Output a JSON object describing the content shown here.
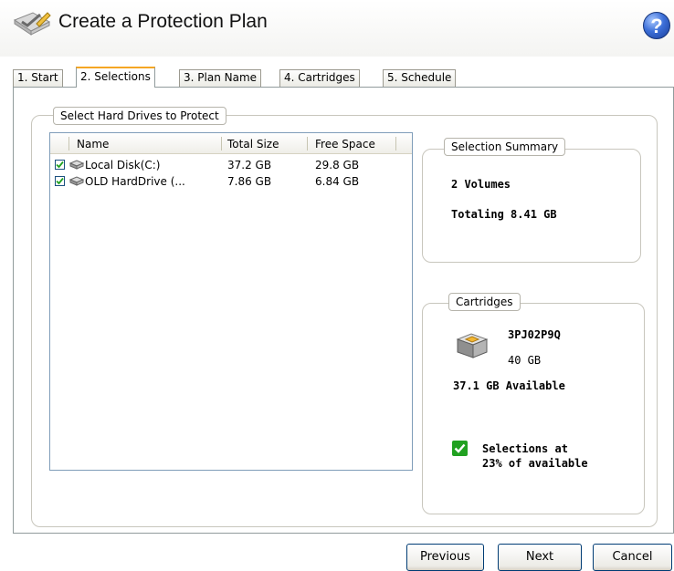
{
  "header": {
    "title": "Create a Protection Plan",
    "help_icon": "help-icon",
    "app_icon": "pen-checklist-icon"
  },
  "tabs": [
    {
      "label": "1. Start",
      "active": false
    },
    {
      "label": "2. Selections",
      "active": true
    },
    {
      "label": "3. Plan Name",
      "active": false
    },
    {
      "label": "4. Cartridges",
      "active": false
    },
    {
      "label": "5. Schedule",
      "active": false
    }
  ],
  "drives": {
    "legend": "Select Hard Drives to Protect",
    "columns": [
      "Name",
      "Total Size",
      "Free Space"
    ],
    "rows": [
      {
        "checked": true,
        "icon": "hard-disk-icon",
        "name": "Local Disk(C:)",
        "total": "37.2 GB",
        "free": "29.8 GB"
      },
      {
        "checked": true,
        "icon": "hard-disk-icon",
        "name": "OLD HardDrive (...",
        "total": "7.86 GB",
        "free": "6.84 GB"
      }
    ]
  },
  "summary": {
    "legend": "Selection Summary",
    "volumes": "2 Volumes",
    "total": "Totaling 8.41 GB"
  },
  "cartridges": {
    "legend": "Cartridges",
    "icon": "cartridge-drive-icon",
    "id": "3PJ02P9Q",
    "size": "40 GB",
    "available": "37.1 GB Available",
    "status_icon": "green-check-icon",
    "status_line1": "Selections at",
    "status_line2": "23% of available"
  },
  "buttons": {
    "previous": "Previous",
    "next": "Next",
    "cancel": "Cancel"
  },
  "colors": {
    "active_tab_accent": "#f5a623",
    "check_green": "#21a121",
    "help_blue": "#3c6fd8"
  }
}
